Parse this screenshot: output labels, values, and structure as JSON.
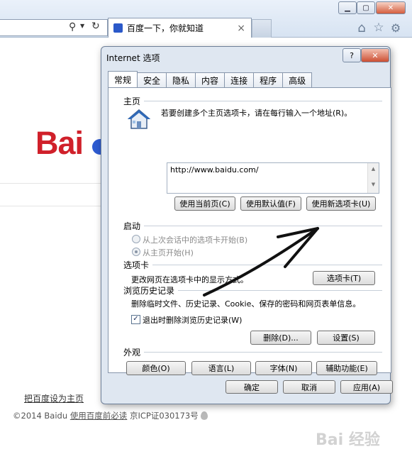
{
  "browser": {
    "tab_title": "百度一下，你就知道",
    "tab_close": "×",
    "search_glyph": "⚲",
    "refresh_glyph": "↻",
    "home_glyph": "⌂",
    "star_glyph": "☆",
    "gear_glyph": "⚙",
    "min_glyph": "▁",
    "max_glyph": "▢",
    "close_glyph": "✕"
  },
  "page": {
    "logo_text": "Bai",
    "set_homepage": "把百度设为主页",
    "footer_copyright": "©2014 Baidu",
    "footer_link": "使用百度前必读",
    "footer_icp": "京ICP证030173号"
  },
  "dialog": {
    "title": "Internet 选项",
    "help_glyph": "?",
    "close_glyph": "✕",
    "tabs": [
      "常规",
      "安全",
      "隐私",
      "内容",
      "连接",
      "程序",
      "高级"
    ],
    "homepage": {
      "header": "主页",
      "hint": "若要创建多个主页选项卡，请在每行输入一个地址(R)。",
      "url": "http://www.baidu.com/",
      "btn_current": "使用当前页(C)",
      "btn_default": "使用默认值(F)",
      "btn_newtab": "使用新选项卡(U)"
    },
    "startup": {
      "header": "启动",
      "option_last": "从上次会话中的选项卡开始(B)",
      "option_home": "从主页开始(H)"
    },
    "tabs_section": {
      "header": "选项卡",
      "desc": "更改网页在选项卡中的显示方式。",
      "btn": "选项卡(T)"
    },
    "history": {
      "header": "浏览历史记录",
      "desc": "删除临时文件、历史记录、Cookie、保存的密码和网页表单信息。",
      "checkbox_label": "退出时删除浏览历史记录(W)",
      "btn_delete": "删除(D)...",
      "btn_settings": "设置(S)"
    },
    "appearance": {
      "header": "外观",
      "btn_colors": "颜色(O)",
      "btn_languages": "语言(L)",
      "btn_fonts": "字体(N)",
      "btn_accessibility": "辅助功能(E)"
    },
    "footer": {
      "ok": "确定",
      "cancel": "取消",
      "apply": "应用(A)"
    }
  },
  "watermark": "Bai 经验"
}
